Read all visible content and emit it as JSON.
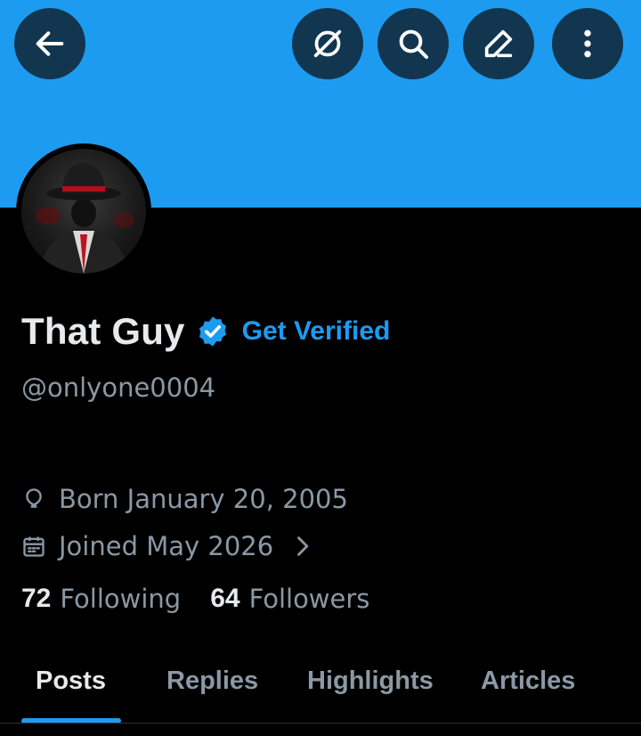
{
  "colors": {
    "banner": "#1d9bf0",
    "accent": "#1d9bf0",
    "muted": "#8b98a5",
    "text": "#e7e9ea"
  },
  "header": {
    "icons": [
      "back-arrow-icon",
      "grok-icon",
      "search-icon",
      "edit-icon",
      "more-vertical-icon"
    ]
  },
  "profile": {
    "display_name": "That Guy",
    "verified_badge_icon": "verified-check-icon",
    "get_verified_label": "Get Verified",
    "handle": "@onlyone0004",
    "born": "Born January 20, 2005",
    "joined": "Joined May 2026",
    "following_count": "72",
    "following_label": "Following",
    "followers_count": "64",
    "followers_label": "Followers"
  },
  "tabs": [
    {
      "label": "Posts",
      "active": true
    },
    {
      "label": "Replies",
      "active": false
    },
    {
      "label": "Highlights",
      "active": false
    },
    {
      "label": "Articles",
      "active": false
    }
  ]
}
